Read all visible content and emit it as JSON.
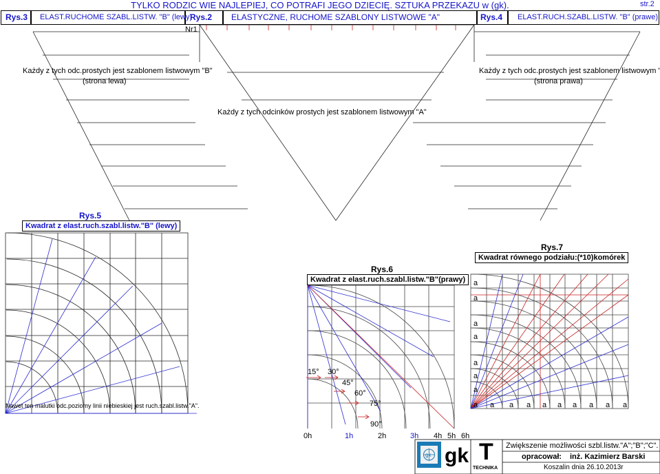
{
  "header": {
    "title": "TYLKO RODZIC WIE NAJLEPIEJ, CO POTRAFI JEGO DZIECIĘ. SZTUKA PRZEKAZU w (gk).",
    "page": "str.2",
    "cells": [
      {
        "fig": "Rys.3",
        "text": "ELAST.RUCHOME SZABL.LISTW. \"B\" (lewy)"
      },
      {
        "fig": "Rys.2",
        "text": "ELASTYCZNE, RUCHOME SZABLONY LISTWOWE \"A\""
      },
      {
        "fig": "Rys.4",
        "text": "ELAST.RUCH.SZABL.LISTW. \"B\" (prawe)"
      }
    ],
    "nr": "Nr1"
  },
  "top": {
    "left_caption": "Każdy z tych odc.prostych jest szablonem listwowym \"B\"",
    "left_sub": "(strona lewa)",
    "right_caption": "Każdy z tych odc.prostych jest szablonem listwowym \"B\"",
    "right_sub": "(strona prawa)",
    "center_caption": "Każdy z tych odcinków prostych jest szablonem listwowym \"A\""
  },
  "rys5": {
    "label": "Rys.5",
    "title": "Kwadrat z elast.ruch.szabl.listw.\"B\" (lewy)"
  },
  "rys6": {
    "label": "Rys.6",
    "title": "Kwadrat z elast.ruch.szabl.listw.\"B\"(prawy)",
    "angles": [
      "15°",
      "30°",
      "45°",
      "60°",
      "75°",
      "90°"
    ],
    "hours": [
      "0h",
      "1h",
      "2h",
      "3h",
      "4h",
      "5h",
      "6h"
    ]
  },
  "rys7": {
    "label": "Rys.7",
    "title": "Kwadrat równego podziału:(*10)komórek",
    "mark": "a"
  },
  "bottom_note": "Nawet ten malutki odc.poziomy linii niebieskiej jest ruch.szabl.listw.\"A\".",
  "stamp": {
    "logo_text": "gk",
    "big_gk": "gk",
    "big_t": "T",
    "technika": "TECHNIKA",
    "line1": "Zwiększenie możliwości szbl.listw.\"A\";\"B\";\"C\".",
    "line2_label": "opracował:",
    "line2_name": "inż. Kazimierz Barski",
    "line3": "Koszalin dnia 26.10.2013r"
  },
  "colors": {
    "blue": "#1515c8",
    "red": "#c81e1e",
    "gray": "#333333"
  }
}
